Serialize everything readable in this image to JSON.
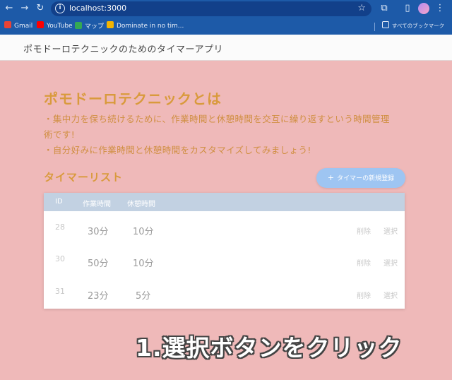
{
  "browser": {
    "url": "localhost:3000",
    "bookmarks": [
      {
        "label": "Gmail",
        "color": "#ea4335"
      },
      {
        "label": "YouTube",
        "color": "#ff0000"
      },
      {
        "label": "マップ",
        "color": "#34a853"
      },
      {
        "label": "Dominate in no tim...",
        "color": "#f4b400"
      }
    ],
    "all_bookmarks": "すべてのブックマーク"
  },
  "app": {
    "title": "ポモドーロテクニックのためのタイマーアプリ"
  },
  "intro": {
    "heading": "ポモドーロテクニックとは",
    "line1a": "・集中力を保ち続けるために、作業時間と休憩時間を交互に繰り返すという時間管理",
    "line1b": "術です!",
    "line2": "・自分好みに作業時間と休憩時間をカスタマイズしてみましょう!"
  },
  "timers": {
    "heading": "タイマーリスト",
    "new_button": "タイマーの新規登録",
    "columns": [
      "ID",
      "作業時間",
      "休憩時間"
    ],
    "rows": [
      {
        "id": "28",
        "work": "30分",
        "rest": "10分",
        "delete": "削除",
        "select": "選択"
      },
      {
        "id": "30",
        "work": "50分",
        "rest": "10分",
        "delete": "削除",
        "select": "選択"
      },
      {
        "id": "31",
        "work": "23分",
        "rest": "5分",
        "delete": "削除",
        "select": "選択"
      }
    ]
  },
  "annotation": "1.選択ボタンをクリック",
  "colors": {
    "page_bg": "#efb9b9",
    "heading": "#d99a3c",
    "button": "#9ec5f2",
    "table_header": "#c2d1e2",
    "browser_chrome": "#1d5aa8"
  }
}
